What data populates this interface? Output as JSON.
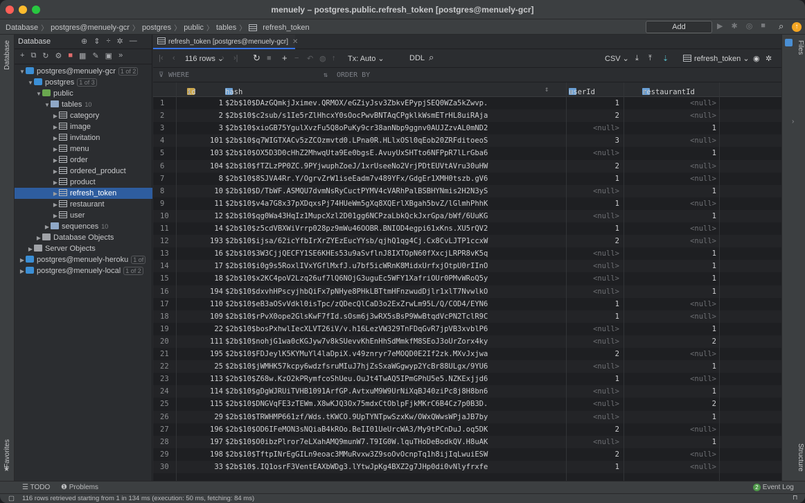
{
  "window": {
    "title": "menuely – postgres.public.refresh_token [postgres@menuely-gcr]"
  },
  "breadcrumb": [
    "Database",
    "postgres@menuely-gcr",
    "postgres",
    "public",
    "tables",
    "refresh_token"
  ],
  "nav": {
    "add_configuration": "Add Configuration..."
  },
  "sidebar_left": {
    "database_label": "Database",
    "favorites_label": "Favorites"
  },
  "sidebar_right": {
    "files_label": "Files",
    "structure_label": "Structure"
  },
  "db_panel": {
    "title": "Database",
    "tree": [
      {
        "label": "postgres@menuely-gcr",
        "badge": "1 of 2",
        "indent": 0,
        "chev": "open",
        "icon": "pg"
      },
      {
        "label": "postgres",
        "badge": "1 of 3",
        "indent": 1,
        "chev": "open",
        "icon": "pg"
      },
      {
        "label": "public",
        "badge": "",
        "indent": 2,
        "chev": "open",
        "icon": "schema"
      },
      {
        "label": "tables",
        "badge": "10",
        "indent": 3,
        "chev": "open",
        "icon": "folder"
      },
      {
        "label": "category",
        "badge": "",
        "indent": 4,
        "chev": "closed",
        "icon": "table"
      },
      {
        "label": "image",
        "badge": "",
        "indent": 4,
        "chev": "closed",
        "icon": "table"
      },
      {
        "label": "invitation",
        "badge": "",
        "indent": 4,
        "chev": "closed",
        "icon": "table"
      },
      {
        "label": "menu",
        "badge": "",
        "indent": 4,
        "chev": "closed",
        "icon": "table"
      },
      {
        "label": "order",
        "badge": "",
        "indent": 4,
        "chev": "closed",
        "icon": "table"
      },
      {
        "label": "ordered_product",
        "badge": "",
        "indent": 4,
        "chev": "closed",
        "icon": "table"
      },
      {
        "label": "product",
        "badge": "",
        "indent": 4,
        "chev": "closed",
        "icon": "table"
      },
      {
        "label": "refresh_token",
        "badge": "",
        "indent": 4,
        "chev": "closed",
        "icon": "table",
        "selected": true
      },
      {
        "label": "restaurant",
        "badge": "",
        "indent": 4,
        "chev": "closed",
        "icon": "table"
      },
      {
        "label": "user",
        "badge": "",
        "indent": 4,
        "chev": "closed",
        "icon": "table"
      },
      {
        "label": "sequences",
        "badge": "10",
        "indent": 3,
        "chev": "closed",
        "icon": "folder"
      },
      {
        "label": "Database Objects",
        "badge": "",
        "indent": 2,
        "chev": "closed",
        "icon": "dbobj"
      },
      {
        "label": "Server Objects",
        "badge": "",
        "indent": 1,
        "chev": "closed",
        "icon": "dbobj"
      },
      {
        "label": "postgres@menuely-heroku",
        "badge": "1 of",
        "indent": 0,
        "chev": "closed",
        "icon": "pg"
      },
      {
        "label": "postgres@menuely-local",
        "badge": "1 of 2",
        "indent": 0,
        "chev": "closed",
        "icon": "pg"
      }
    ]
  },
  "editor": {
    "tab_label": "refresh_token [postgres@menuely-gcr]",
    "rows_label": "116 rows",
    "tx_label": "Tx: Auto",
    "ddl_label": "DDL",
    "csv_label": "CSV",
    "table_selector": "refresh_token",
    "where_label": "WHERE",
    "order_by_label": "ORDER BY"
  },
  "grid": {
    "columns": [
      "id",
      "hash",
      "userId",
      "restaurantId"
    ],
    "rows": [
      [
        1,
        1,
        "$2b$10$DAzGQmkjJximev.QRMOX/eGZiyJsv3ZbkvEPypjSEQ0WZa5kZwvp.",
        "1",
        "<null>"
      ],
      [
        2,
        2,
        "$2b$10$c2sub/s1Ie5rZlHhcxY0sOocPwvBNTAqCPgklkWsmETrHL8uiRAja",
        "2",
        "<null>"
      ],
      [
        3,
        3,
        "$2b$10$xioGB75YgulXvzFu5Q8oPuKy9cr38anNbp9ggnv0AUJZzvAL0mND2",
        "<null>",
        "1"
      ],
      [
        4,
        101,
        "$2b$10$q7WIGTXACv5zZCOzmvtd0.LPna0R.HLlxOSl0qEob20ZRFditoeoS",
        "3",
        "<null>"
      ],
      [
        5,
        103,
        "$2b$10$OX5D3D0cHhZ2MhwqUta9Ee0bgsE.AvuyUxSHTto6NFPpR7lLrGba6",
        "<null>",
        "1"
      ],
      [
        6,
        104,
        "$2b$10$fTZLzPP0ZC.9PYjwuphZoeJ/1xrUseeNo2VrjPDtEUVtAVru30uHW",
        "2",
        "<null>"
      ],
      [
        7,
        8,
        "$2b$10$8SJVA4Rr.Y/OgrvZrW1iseEadm7v489YFx/GdgEr1XMH0tszb.gV6",
        "1",
        "<null>"
      ],
      [
        8,
        10,
        "$2b$10$D/TbWF.ASMQU7dvmNsRyCuctPYMV4cVARhPalBSBHYNmis2H2N3yS",
        "<null>",
        "1"
      ],
      [
        9,
        11,
        "$2b$10$v4a7G8x37pXDqxsPj74HUeWm5gXq8XQErlXBgah5bvZ/lGlmhPhhK",
        "1",
        "<null>"
      ],
      [
        10,
        12,
        "$2b$10$qg0Wa43HqIz1MupcXzl2D01gg6NCPzaLbkQckJxrGpa/bWf/6UuKG",
        "<null>",
        "1"
      ],
      [
        11,
        14,
        "$2b$10$z5cdVBXWiVrrp028pz9mWu46OOBR.BNIOD4egpi61xKns.XU5rQV2",
        "1",
        "<null>"
      ],
      [
        12,
        193,
        "$2b$10$ijsa/62icYfbIrXrZYEzEucYYsb/qjhQ1qg4Cj.Cx8CvLJTP1ccxW",
        "2",
        "<null>"
      ],
      [
        13,
        16,
        "$2b$10$3W3CjjQECFY1SE6KHEs53u9aSvflnJ8IXTOpN60fXxcjLRPR8vK5q",
        "<null>",
        "1"
      ],
      [
        14,
        17,
        "$2b$10$i0g9s5RoxlIVxYGflMxfJ.u7bf5icWRnK8MidxUrfxjOtpU0rIInO",
        "<null>",
        "1"
      ],
      [
        15,
        18,
        "$2b$10$x2KC4poV2Lzq26uf7lQ6NOjG3uguEc5WFY1XafriOUr0PMvWRoQ5y",
        "<null>",
        "1"
      ],
      [
        16,
        194,
        "$2b$10$dxvhHPscyjhbQiFx7pNHye8PHkLBTtmHFnzwudDjlr1xlT7NvwlkO",
        "<null>",
        "1"
      ],
      [
        17,
        110,
        "$2b$10$eB3aOSvVdkl0isTpc/zQDecQlCaD3o2ExZrwLm95L/Q/COD4/EYN6",
        "1",
        "<null>"
      ],
      [
        18,
        109,
        "$2b$10$rPvX0ope2GlsKwF7fId.sOsm6j3wRX5sBsP9WwBtqdVcPN2TclR9C",
        "1",
        "<null>"
      ],
      [
        19,
        22,
        "$2b$10$bosPxhwlIecXLVT26iV/v.h16LezVW329TnFDqGvR7jpVB3xvblP6",
        "<null>",
        "1"
      ],
      [
        20,
        111,
        "$2b$10$nohjG1wa0cKGJyw7v8kSUevvKhEnHhSdMmkfM8SEoJ3oUrZorx4ky",
        "<null>",
        "2"
      ],
      [
        21,
        195,
        "$2b$10$FDJeylK5KYMuYl4laDpiX.v49znryr7eMOQD0E2If2zk.MXvJxjwa",
        "2",
        "<null>"
      ],
      [
        22,
        25,
        "$2b$10$jWMHK57kcpy6wdzfsruMIuJ7hjZsSxaWGgwyp2YcBr88ULgx/9YU6",
        "<null>",
        "1"
      ],
      [
        23,
        113,
        "$2b$10$Z68w.KzO2kPRymfcoShUeu.OuJt4TwAQ5IPmGPhU5e5.NZKExjjd6",
        "1",
        "<null>"
      ],
      [
        24,
        114,
        "$2b$10$gDgWJRUiTVHB1091ArfGP.AvtxuM9W9UrNiXqBJ40ziPc8j8H8bn6",
        "<null>",
        "1"
      ],
      [
        25,
        115,
        "$2b$10$DNGVqFE3zTEWm.X8wKJQ3Ox75mdxCtOblpFjkMKrC6B4Cz7p0B3D.",
        "<null>",
        "2"
      ],
      [
        26,
        29,
        "$2b$10$TRWHMP661zf/Wds.tKWCO.9UpTYNTpwSzxKw/OWxQWwsWPjaJB7by",
        "<null>",
        "1"
      ],
      [
        27,
        196,
        "$2b$10$OD6IFeMON3sNQiaB4kROo.BeII01UeUrcWA3/My9tPCnDuJ.oq5DK",
        "2",
        "<null>"
      ],
      [
        28,
        197,
        "$2b$10$O0ibzPlror7eLXahAMQ9munW7.T9IG0W.lquTHoDeBodkQV.H8uAK",
        "<null>",
        "1"
      ],
      [
        29,
        198,
        "$2b$10$TftpINrEgGILn9eoac3MMuRvxw3Z9soOvOcnpTq1h8ijIqLwuiESW",
        "2",
        "<null>"
      ],
      [
        30,
        33,
        "$2b$10$.IQ1osrF3VentEAXbWDg3.lYtwJpKg4BXZ2g7JHp0di0vNlyfrxfe",
        "1",
        "<null>"
      ]
    ]
  },
  "bottom": {
    "todo": "TODO",
    "problems": "Problems",
    "event_log": "Event Log",
    "event_count": "2"
  },
  "status": {
    "message": "116 rows retrieved starting from 1 in 134 ms (execution: 50 ms, fetching: 84 ms)"
  },
  "colors": {
    "selection": "#2e5d9f",
    "accent_tab": "#3574f0",
    "update": "#f5a623"
  }
}
